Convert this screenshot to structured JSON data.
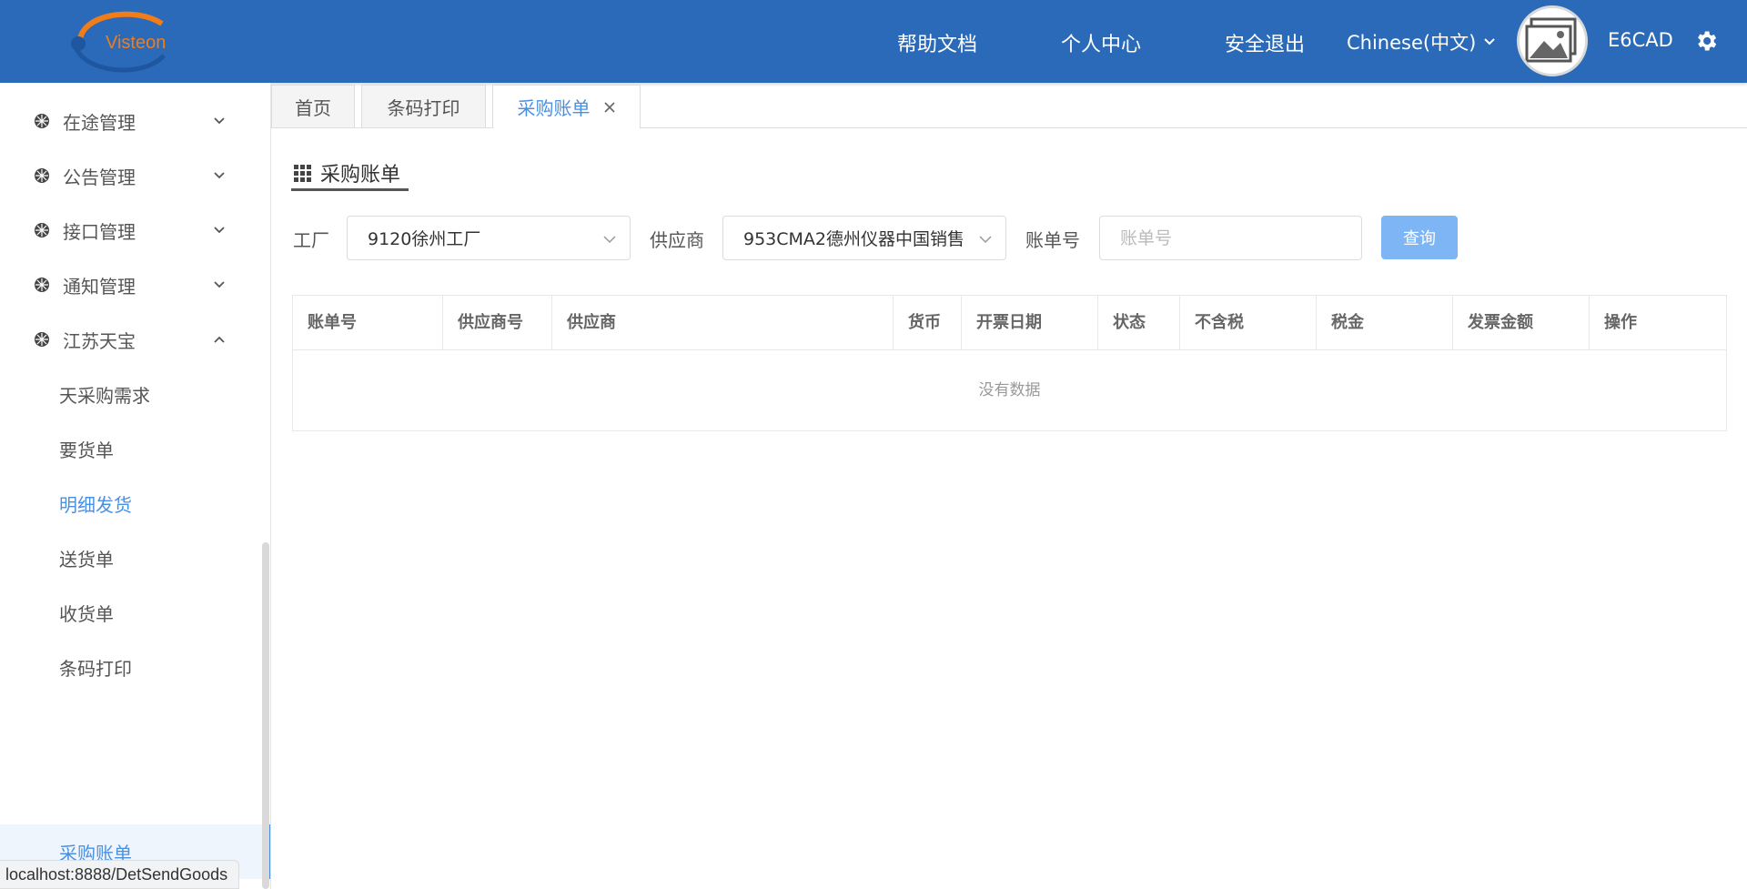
{
  "header": {
    "logo_text": "Visteon",
    "nav": [
      "帮助文档",
      "个人中心",
      "安全退出"
    ],
    "language": "Chinese(中文)",
    "username": "E6CAD"
  },
  "sidebar": {
    "groups": [
      {
        "label": "在途管理",
        "expanded": false
      },
      {
        "label": "公告管理",
        "expanded": false
      },
      {
        "label": "接口管理",
        "expanded": false
      },
      {
        "label": "通知管理",
        "expanded": false
      },
      {
        "label": "江苏天宝",
        "expanded": true
      }
    ],
    "sub_items": [
      "天采购需求",
      "要货单",
      "明细发货",
      "送货单",
      "收货单",
      "条码打印",
      "采购账单"
    ]
  },
  "status_url": "localhost:8888/DetSendGoods",
  "tabs": [
    "首页",
    "条码打印",
    "采购账单"
  ],
  "page": {
    "title": "采购账单",
    "filters": {
      "factory_label": "工厂",
      "factory_value": "9120徐州工厂",
      "supplier_label": "供应商",
      "supplier_value": "953CMA2德州仪器中国销售",
      "bill_label": "账单号",
      "bill_placeholder": "账单号"
    },
    "query_button": "查询"
  },
  "table": {
    "columns": [
      "账单号",
      "供应商号",
      "供应商",
      "货币",
      "开票日期",
      "状态",
      "不含税",
      "税金",
      "发票金额",
      "操作"
    ],
    "empty_text": "没有数据"
  },
  "colors": {
    "header_bg": "#2a6ab8",
    "accent": "#4a90e2",
    "button": "#7eb6f5"
  }
}
